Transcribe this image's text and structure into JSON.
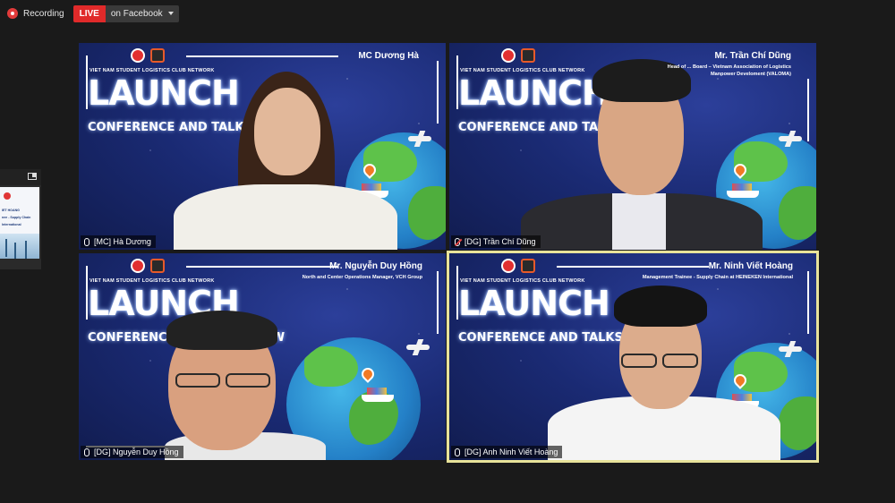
{
  "recording": {
    "label": "Recording"
  },
  "live": {
    "badge": "LIVE",
    "target": "on Facebook"
  },
  "event": {
    "network": "VIET NAM STUDENT LOGISTICS CLUB NETWORK",
    "headline": "LAUNCH",
    "subline": "CONFERENCE AND TALKSHOW"
  },
  "tiles": [
    {
      "speaker": "MC Dương Hà",
      "subtitle": [
        "",
        ""
      ],
      "label": "[MC] Hà Dương",
      "active": false
    },
    {
      "speaker": "Mr. Trần Chí Dũng",
      "subtitle": [
        "Head of ... Board – Vietnam Association of Logistics",
        "Manpower Develoment (VALOMA)"
      ],
      "label": "[DG]  Trần Chí Dũng",
      "active": false
    },
    {
      "speaker": "Mr. Nguyễn Duy Hồng",
      "subtitle": [
        "North and Center Operations Manager, VCH Group",
        ""
      ],
      "label": "[DG]  Nguyễn Duy Hồng",
      "active": false
    },
    {
      "speaker": "Mr. Ninh Viết Hoàng",
      "subtitle": [
        "Management Trainee - Supply Chain at HEINEKEN International",
        ""
      ],
      "label": "[DG]  Anh Ninh Viết Hoàng",
      "active": true
    }
  ],
  "side_thumbnail": {
    "lines": [
      "IET HOANG",
      "nee - Supply Chain",
      "International"
    ]
  },
  "colors": {
    "live_red": "#e02a2a",
    "active_outline": "#e8e39a",
    "background": "#1a1a1a"
  }
}
